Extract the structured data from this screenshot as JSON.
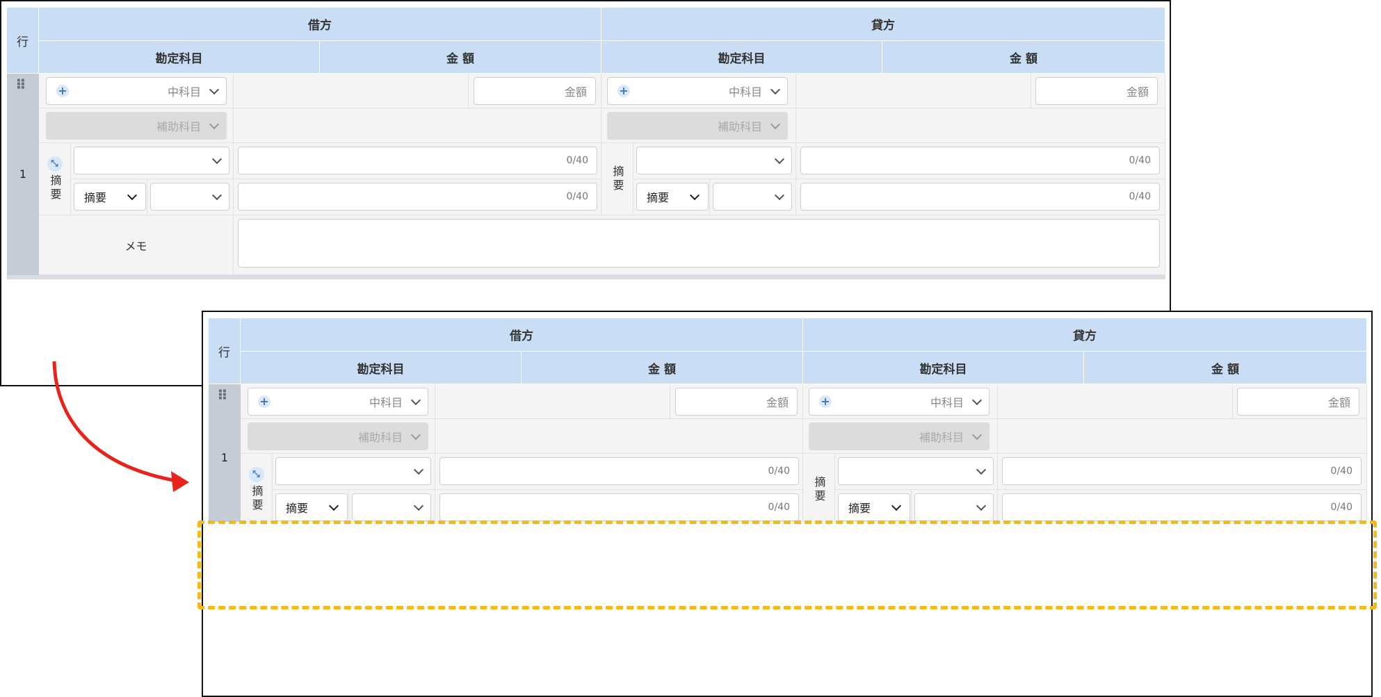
{
  "header": {
    "row_label": "行",
    "debit_label": "借方",
    "credit_label": "貸方",
    "account_label": "勘定科目",
    "amount_label": "金 額"
  },
  "row": {
    "number": "1",
    "mid_account_placeholder": "中科目",
    "amount_placeholder": "金額",
    "sub_account_placeholder": "補助科目",
    "summary_label": "摘要",
    "summary_select_value": "摘要",
    "text_counter": "0/40",
    "memo_label": "メモ"
  },
  "annotation": {
    "arrow_color": "#e8231c",
    "highlight_color": "#f5b91a"
  }
}
